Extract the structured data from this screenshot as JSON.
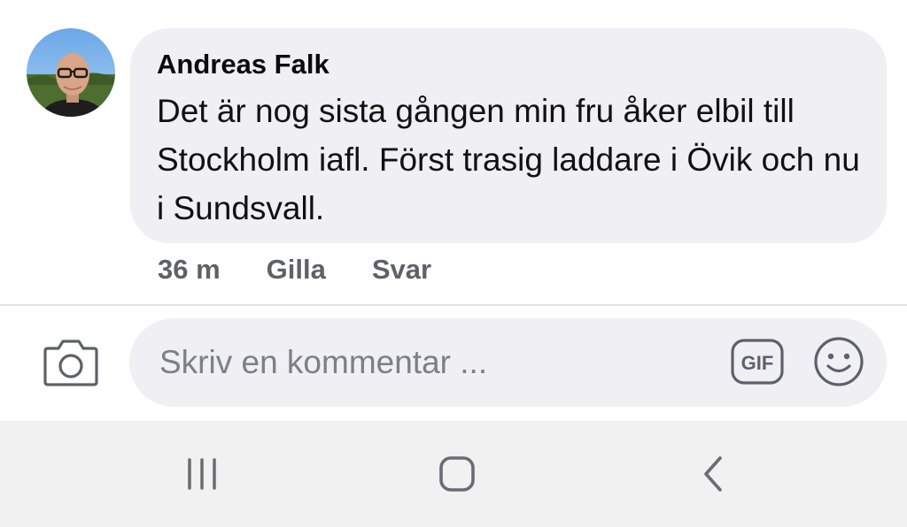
{
  "comment": {
    "author": "Andreas Falk",
    "text": "Det är nog sista gången min fru åker elbil till Stockholm iafl. Först trasig laddare i Övik och nu i Sundsvall.",
    "timestamp": "36 m",
    "like_label": "Gilla",
    "reply_label": "Svar",
    "avatar_icon": "profile-photo"
  },
  "composer": {
    "placeholder": "Skriv en kommentar ...",
    "camera_icon": "camera-icon",
    "gif_label": "GIF",
    "emoji_icon": "smiley-icon"
  },
  "navbar": {
    "recents_icon": "recents-icon",
    "home_icon": "home-icon",
    "back_icon": "back-icon"
  },
  "colors": {
    "bubble": "#efeff4",
    "navbar": "#f1f1f1",
    "meta_text": "#5e6168",
    "icon": "#5e6168"
  }
}
